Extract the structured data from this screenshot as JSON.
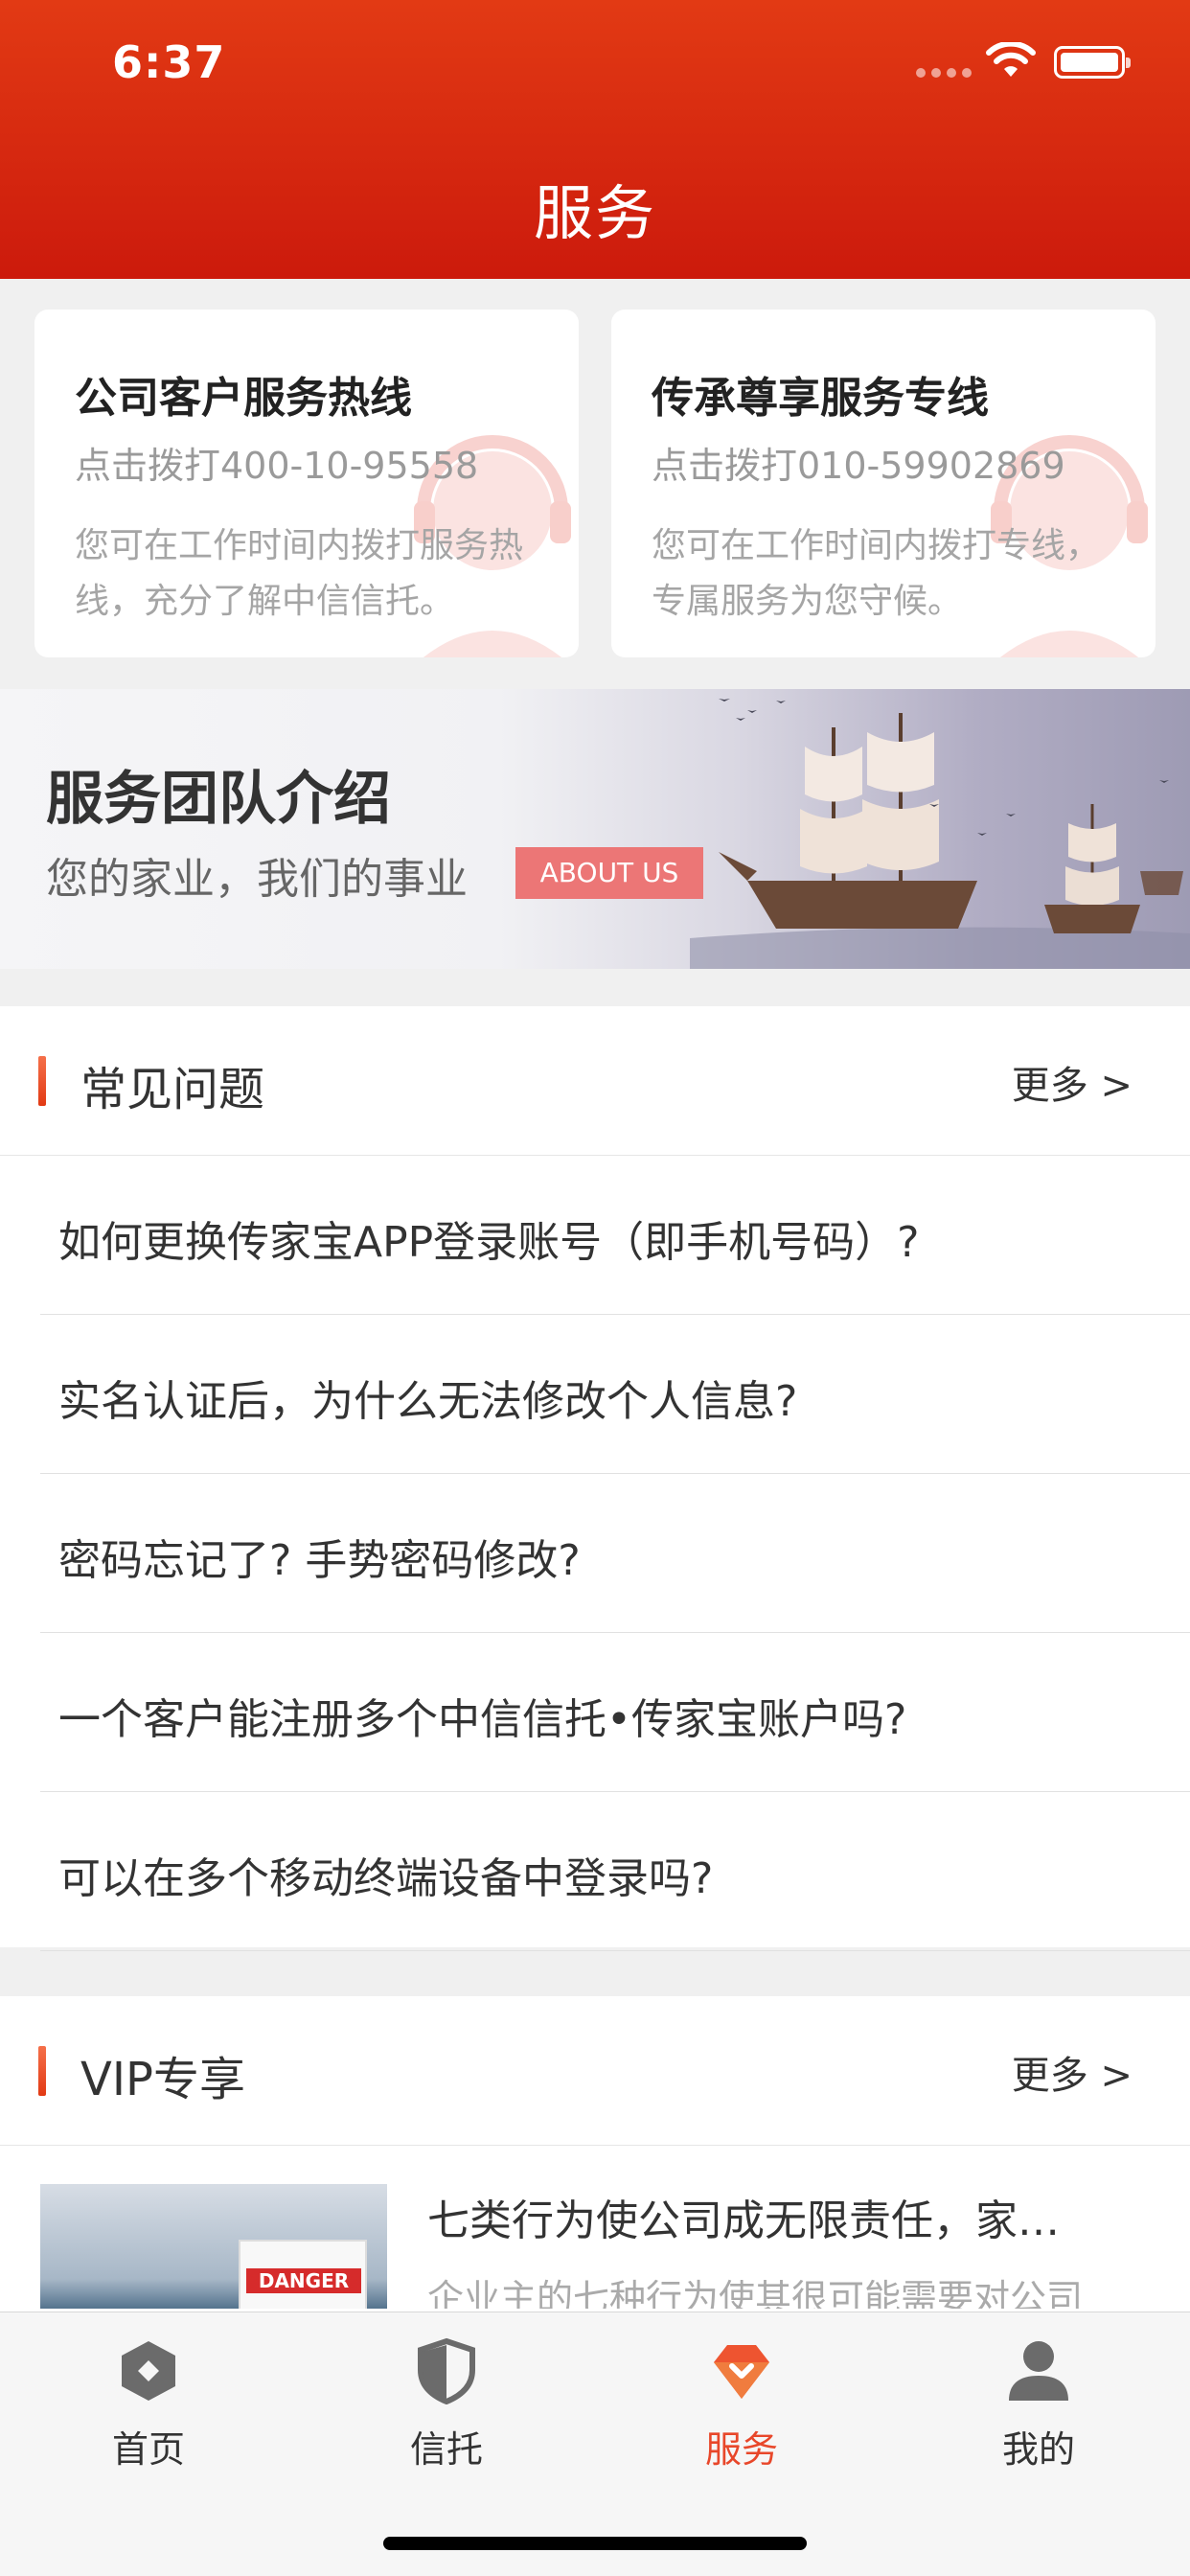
{
  "status_bar": {
    "time": "6:37"
  },
  "header": {
    "title": "服务"
  },
  "hotlines": [
    {
      "title": "公司客户服务热线",
      "phone": "点击拨打400-10-95558",
      "desc": "您可在工作时间内拨打服务热线，充分了解中信信托。"
    },
    {
      "title": "传承尊享服务专线",
      "phone": "点击拨打010-59902869",
      "desc": "您可在工作时间内拨打专线，专属服务为您守候。"
    }
  ],
  "banner": {
    "title": "服务团队介绍",
    "subtitle": "您的家业，我们的事业",
    "button": "ABOUT US"
  },
  "faq": {
    "title": "常见问题",
    "more": "更多 >",
    "items": [
      "如何更换传家宝APP登录账号（即手机号码）?",
      "实名认证后，为什么无法修改个人信息?",
      "密码忘记了? 手势密码修改?",
      "一个客户能注册多个中信信托•传家宝账户吗?",
      "可以在多个移动终端设备中登录吗?"
    ]
  },
  "vip": {
    "title": "VIP专享",
    "more": "更多 >",
    "article": {
      "title": "七类行为使公司成无限责任，家…",
      "desc": "企业主的七种行为使其很可能需要对公司",
      "thumb_label": "DANGER"
    }
  },
  "tabbar": {
    "items": [
      {
        "label": "首页",
        "icon": "home-hexagon-icon"
      },
      {
        "label": "信托",
        "icon": "trust-shield-icon"
      },
      {
        "label": "服务",
        "icon": "service-diamond-icon",
        "active": true
      },
      {
        "label": "我的",
        "icon": "user-profile-icon"
      }
    ],
    "active_color": "#e8472a"
  },
  "colors": {
    "header": "#d82a10",
    "accent": "#e8472a",
    "about_button": "#ec7676"
  }
}
